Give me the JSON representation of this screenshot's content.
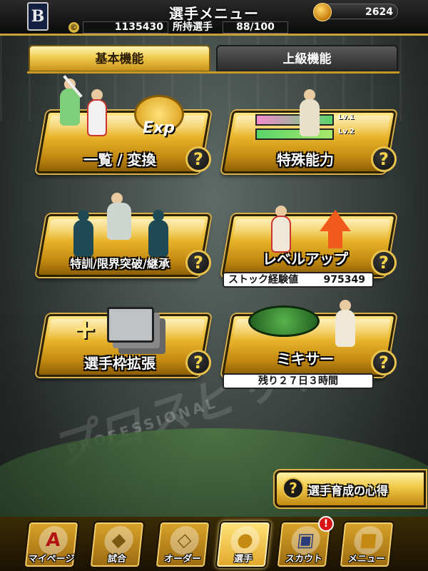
{
  "header": {
    "title": "選手メニュー",
    "team_logo": "B",
    "coins": "2624",
    "money_icon": "©",
    "money": "1135430",
    "owned_label": "所持選手",
    "owned": "88/100"
  },
  "tabs": [
    {
      "label": "基本機能",
      "active": true
    },
    {
      "label": "上級機能",
      "active": false
    }
  ],
  "menu": {
    "list_convert": {
      "label": "一覧 / 変換",
      "badge": "Exp"
    },
    "special_ability": {
      "label": "特殊能力",
      "lv1": "Lv.1",
      "lv2": "Lv.2"
    },
    "training": {
      "label": "特訓/限界突破/継承"
    },
    "level_up": {
      "label": "レベルアップ",
      "stock_label": "ストック経験値",
      "stock_value": "975349"
    },
    "expand": {
      "label": "選手枠拡張"
    },
    "mixer": {
      "label": "ミキサー",
      "remaining": "残り２７日３時間"
    },
    "help_glyph": "?"
  },
  "tips": {
    "label": "選手育成の心得",
    "glyph": "?"
  },
  "nav": [
    {
      "label": "マイページ",
      "glyph": "A",
      "active": false
    },
    {
      "label": "試合",
      "glyph": "◆",
      "active": false
    },
    {
      "label": "オーダー",
      "glyph": "◇",
      "active": false
    },
    {
      "label": "選手",
      "glyph": "●",
      "active": true
    },
    {
      "label": "スカウト",
      "glyph": "▣",
      "active": false
    },
    {
      "label": "メニュー",
      "glyph": "■",
      "active": false
    }
  ],
  "nav_alert": "!",
  "background": {
    "watermark": "プロスピリッツ",
    "watermark_sub": "PROFESSIONAL"
  },
  "colors": {
    "gold": "#e9b62c",
    "dark": "#111111",
    "alert": "#d81515"
  }
}
